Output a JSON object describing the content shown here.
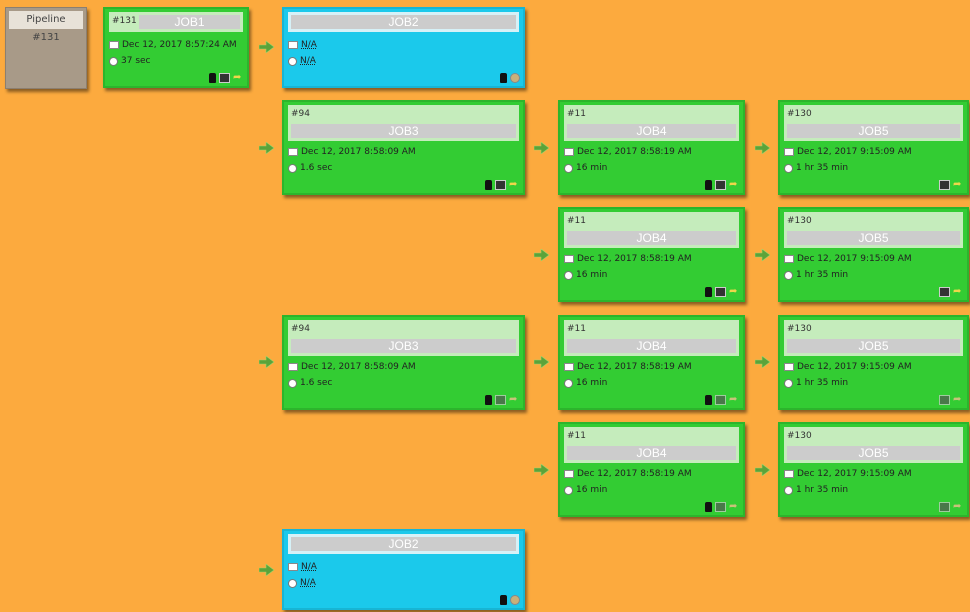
{
  "pipeline": {
    "label": "Pipeline",
    "build": "#131"
  },
  "cards": [
    {
      "id": "job1",
      "build": "#131",
      "name": "JOB1",
      "date": "Dec 12, 2017 8:57:24 AM",
      "duration": "37 sec",
      "status_color": "#33CC33"
    },
    {
      "id": "job2_top",
      "build": "",
      "name": "JOB2",
      "date": "N/A",
      "duration": "N/A",
      "status_color": "#1BC9EB"
    },
    {
      "id": "job3_a",
      "build": "#94",
      "name": "JOB3",
      "date": "Dec 12, 2017 8:58:09 AM",
      "duration": "1.6 sec",
      "status_color": "#33CC33"
    },
    {
      "id": "job4_a",
      "build": "#11",
      "name": "JOB4",
      "date": "Dec 12, 2017 8:58:19 AM",
      "duration": "16 min",
      "status_color": "#33CC33"
    },
    {
      "id": "job5_a",
      "build": "#130",
      "name": "JOB5",
      "date": "Dec 12, 2017 9:15:09 AM",
      "duration": "1 hr 35 min",
      "status_color": "#33CC33"
    },
    {
      "id": "job4_b",
      "build": "#11",
      "name": "JOB4",
      "date": "Dec 12, 2017 8:58:19 AM",
      "duration": "16 min",
      "status_color": "#33CC33"
    },
    {
      "id": "job5_b",
      "build": "#130",
      "name": "JOB5",
      "date": "Dec 12, 2017 9:15:09 AM",
      "duration": "1 hr 35 min",
      "status_color": "#33CC33"
    },
    {
      "id": "job3_b",
      "build": "#94",
      "name": "JOB3",
      "date": "Dec 12, 2017 8:58:09 AM",
      "duration": "1.6 sec",
      "status_color": "#33CC33"
    },
    {
      "id": "job4_c",
      "build": "#11",
      "name": "JOB4",
      "date": "Dec 12, 2017 8:58:19 AM",
      "duration": "16 min",
      "status_color": "#33CC33"
    },
    {
      "id": "job5_c",
      "build": "#130",
      "name": "JOB5",
      "date": "Dec 12, 2017 9:15:09 AM",
      "duration": "1 hr 35 min",
      "status_color": "#33CC33"
    },
    {
      "id": "job4_d",
      "build": "#11",
      "name": "JOB4",
      "date": "Dec 12, 2017 8:58:19 AM",
      "duration": "16 min",
      "status_color": "#33CC33"
    },
    {
      "id": "job5_d",
      "build": "#130",
      "name": "JOB5",
      "date": "Dec 12, 2017 9:15:09 AM",
      "duration": "1 hr 35 min",
      "status_color": "#33CC33"
    },
    {
      "id": "job2_bottom",
      "build": "",
      "name": "JOB2",
      "date": "N/A",
      "duration": "N/A",
      "status_color": "#1BC9EB"
    }
  ],
  "colors": {
    "background": "#FCAA3E",
    "success": "#33CC33",
    "pending": "#1BC9EB",
    "pipeline_box": "#A89A88"
  }
}
